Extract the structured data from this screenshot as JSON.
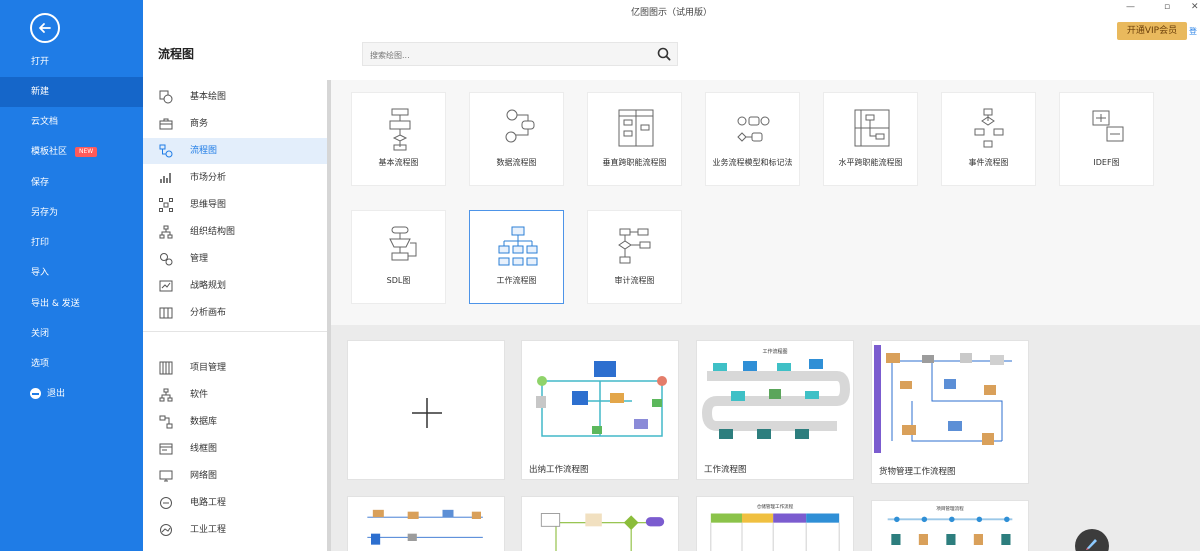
{
  "window": {
    "title": "亿图图示（试用版）",
    "vip_button": "开通VIP会员",
    "vip_extra": "登"
  },
  "sidebar": {
    "items": [
      {
        "label": "打开"
      },
      {
        "label": "新建"
      },
      {
        "label": "云文档"
      },
      {
        "label": "模板社区",
        "badge": "NEW"
      },
      {
        "label": "保存"
      },
      {
        "label": "另存为"
      },
      {
        "label": "打印"
      },
      {
        "label": "导入"
      },
      {
        "label": "导出 & 发送"
      },
      {
        "label": "关闭"
      },
      {
        "label": "选项"
      },
      {
        "label": "退出"
      }
    ],
    "accent": "#1f7ce6"
  },
  "header": {
    "title": "流程图",
    "search_placeholder": "搜索绘图..."
  },
  "categories": {
    "group1": [
      {
        "label": "基本绘图",
        "icon": "shapes-icon"
      },
      {
        "label": "商务",
        "icon": "briefcase-icon"
      },
      {
        "label": "流程图",
        "icon": "flowchart-icon"
      },
      {
        "label": "市场分析",
        "icon": "bar-chart-icon"
      },
      {
        "label": "思维导图",
        "icon": "mindmap-icon"
      },
      {
        "label": "组织结构图",
        "icon": "org-chart-icon"
      },
      {
        "label": "管理",
        "icon": "management-icon"
      },
      {
        "label": "战略规划",
        "icon": "strategy-icon"
      },
      {
        "label": "分析画布",
        "icon": "canvas-icon"
      }
    ],
    "group2": [
      {
        "label": "项目管理",
        "icon": "gantt-icon"
      },
      {
        "label": "软件",
        "icon": "software-icon"
      },
      {
        "label": "数据库",
        "icon": "database-icon"
      },
      {
        "label": "线框图",
        "icon": "wireframe-icon"
      },
      {
        "label": "网络图",
        "icon": "network-icon"
      },
      {
        "label": "电路工程",
        "icon": "circuit-icon"
      },
      {
        "label": "工业工程",
        "icon": "industry-icon"
      }
    ]
  },
  "types": [
    {
      "label": "基本流程图"
    },
    {
      "label": "数据流程图"
    },
    {
      "label": "垂直跨职能流程图"
    },
    {
      "label": "业务流程模型和标记法"
    },
    {
      "label": "水平跨职能流程图"
    },
    {
      "label": "事件流程图"
    },
    {
      "label": "IDEF图"
    },
    {
      "label": "SDL图"
    },
    {
      "label": "工作流程图"
    },
    {
      "label": "审计流程图"
    }
  ],
  "templates": [
    {
      "label": "出纳工作流程图"
    },
    {
      "label": "工作流程图"
    },
    {
      "label": "货物管理工作流程图"
    }
  ],
  "thumbnail_headings": [
    "工作流程图",
    "仓储管理工作流程",
    "项目管理流程"
  ]
}
